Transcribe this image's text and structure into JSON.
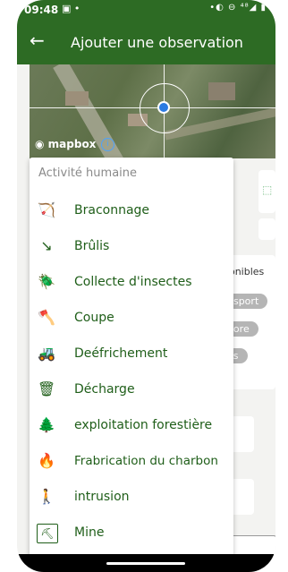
{
  "status": {
    "time": "09:48",
    "left_icons": "▣ •",
    "right_icons": "•◐ ⊖ ⁴⁸◢ ▮"
  },
  "appbar": {
    "title": "Ajouter une observation"
  },
  "map": {
    "logo": "mapbox",
    "info": "i"
  },
  "background": {
    "disponibles": "ponibles",
    "chips": [
      "nsport",
      "flore",
      "es"
    ],
    "icon_right": "⬚"
  },
  "menu": {
    "header": "Activité humaine",
    "items": [
      {
        "label": "Braconnage",
        "icon": "🏹"
      },
      {
        "label": "Brûlis",
        "icon": "↘"
      },
      {
        "label": "Collecte d'insectes",
        "icon": "🪲"
      },
      {
        "label": "Coupe",
        "icon": "🪓"
      },
      {
        "label": "Deéfrichement",
        "icon": "🚜"
      },
      {
        "label": "Décharge",
        "icon": "🗑"
      },
      {
        "label": "exploitation forestière",
        "icon": "🌲"
      },
      {
        "label": "Frabrication du charbon",
        "icon": "🔥"
      },
      {
        "label": "intrusion",
        "icon": "🚶"
      },
      {
        "label": "Mine",
        "icon": "⛏"
      }
    ]
  }
}
